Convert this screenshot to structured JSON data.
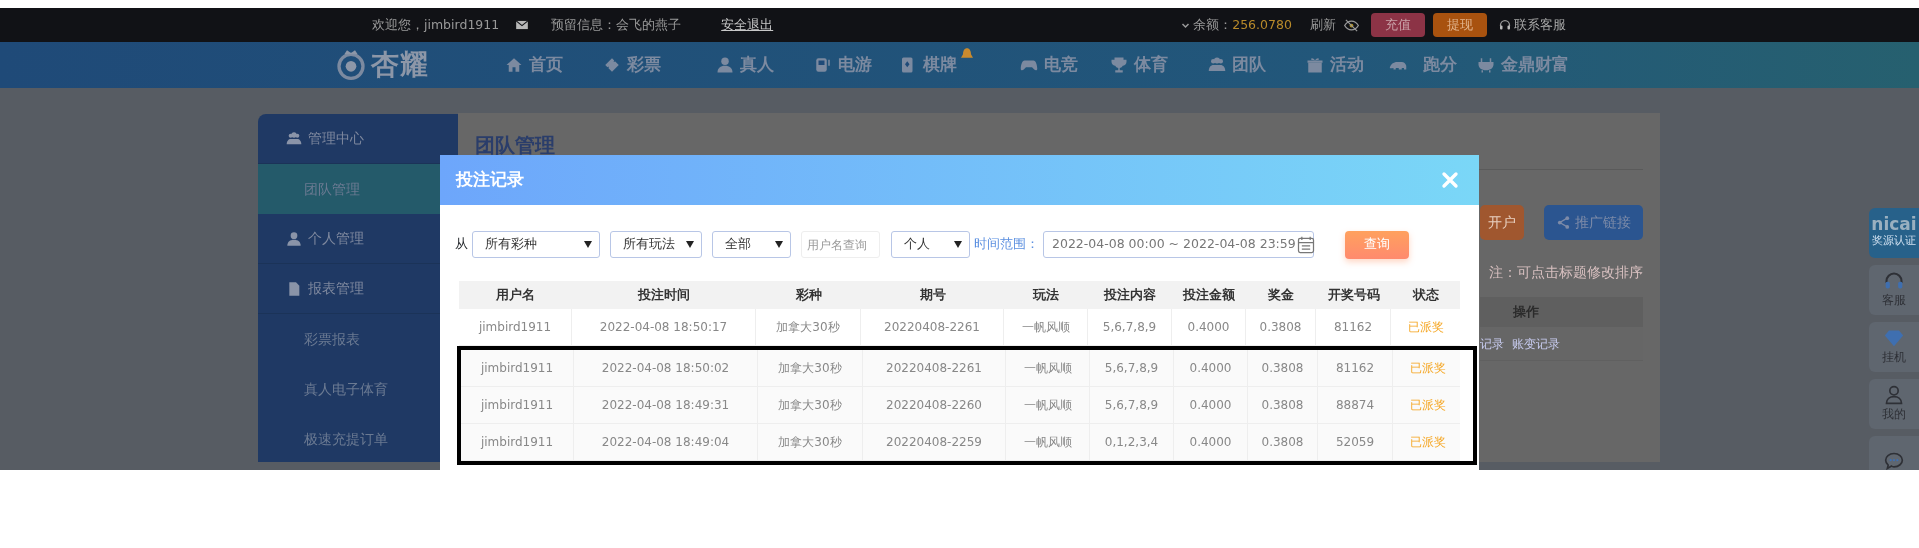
{
  "top_bar": {
    "welcome": "欢迎您，jimbird1911",
    "reserved_info": "预留信息：会飞的燕子",
    "logout": "安全退出",
    "balance_label": "余额：",
    "balance": "256.0780",
    "refresh": "刷新",
    "buttons": [
      {
        "label": "充值",
        "kind": "deposit"
      },
      {
        "label": "提现",
        "kind": "withdraw"
      }
    ],
    "support": "联系客服"
  },
  "nav": {
    "logo": "杏耀",
    "items": [
      {
        "label": "首页",
        "hot": false
      },
      {
        "label": "彩票",
        "hot": false
      },
      {
        "label": "真人",
        "hot": false
      },
      {
        "label": "电游",
        "hot": false
      },
      {
        "label": "棋牌",
        "hot": true
      },
      {
        "label": "电竞",
        "hot": false
      },
      {
        "label": "体育",
        "hot": false
      },
      {
        "label": "团队",
        "hot": false
      },
      {
        "label": "活动",
        "hot": false
      },
      {
        "label": "跑分",
        "hot": false
      },
      {
        "label": "金鼎财富",
        "hot": false
      }
    ]
  },
  "sidebar": {
    "groups": [
      {
        "label": "管理中心",
        "children": [
          {
            "label": "团队管理",
            "selected": true
          }
        ]
      },
      {
        "label": "个人管理"
      },
      {
        "label": "报表管理",
        "children": [
          {
            "label": "彩票报表",
            "selected": false
          },
          {
            "label": "真人电子体育",
            "selected": false
          },
          {
            "label": "极速充提订单",
            "selected": false
          }
        ]
      }
    ]
  },
  "page": {
    "title": "团队管理",
    "buttons": [
      {
        "label": "开户",
        "kind": "open-account"
      },
      {
        "label": "推广链接",
        "kind": "share"
      }
    ],
    "note": "注：可点击标题修改排序",
    "table": {
      "columns": [
        "操作"
      ],
      "links": [
        "记录",
        "账变记录"
      ]
    }
  },
  "modal": {
    "title": "投注记录",
    "filters": {
      "from_label": "从",
      "selects": [
        {
          "value": "所有彩种"
        },
        {
          "value": "所有玩法"
        },
        {
          "value": "全部"
        }
      ],
      "username": {
        "placeholder": "用户名查询"
      },
      "scope": {
        "value": "个人"
      },
      "time_label": "时间范围：",
      "time_range": "2022-04-08 00:00 ~ 2022-04-08 23:59",
      "query": "查询"
    },
    "table": {
      "columns": [
        "用户名",
        "投注时间",
        "彩种",
        "期号",
        "玩法",
        "投注内容",
        "投注金额",
        "奖金",
        "开奖号码",
        "状态"
      ],
      "rows": [
        {
          "cells": [
            "jimbird1911",
            "2022-04-08 18:50:17",
            "加拿大30秒",
            "20220408-2261",
            "一帆风顺",
            "5,6,7,8,9",
            "0.4000",
            "0.3808",
            "81162",
            "已派奖"
          ],
          "highlighted": false
        },
        {
          "cells": [
            "jimbird1911",
            "2022-04-08 18:50:02",
            "加拿大30秒",
            "20220408-2261",
            "一帆风顺",
            "5,6,7,8,9",
            "0.4000",
            "0.3808",
            "81162",
            "已派奖"
          ],
          "highlighted": true
        },
        {
          "cells": [
            "jimbird1911",
            "2022-04-08 18:49:31",
            "加拿大30秒",
            "20220408-2260",
            "一帆风顺",
            "5,6,7,8,9",
            "0.4000",
            "0.3808",
            "88874",
            "已派奖"
          ],
          "highlighted": true
        },
        {
          "cells": [
            "jimbird1911",
            "2022-04-08 18:49:04",
            "加拿大30秒",
            "20220408-2259",
            "一帆风顺",
            "0,1,2,3,4",
            "0.4000",
            "0.3808",
            "52059",
            "已派奖"
          ],
          "highlighted": true
        }
      ]
    }
  },
  "right_rail": {
    "items": [
      {
        "kind": "logo",
        "logo": "nicai",
        "label": "奖源认证"
      },
      {
        "kind": "icon",
        "label": "客服"
      },
      {
        "kind": "icon",
        "label": "挂机"
      },
      {
        "kind": "icon",
        "label": "我的"
      },
      {
        "kind": "icon"
      }
    ]
  }
}
